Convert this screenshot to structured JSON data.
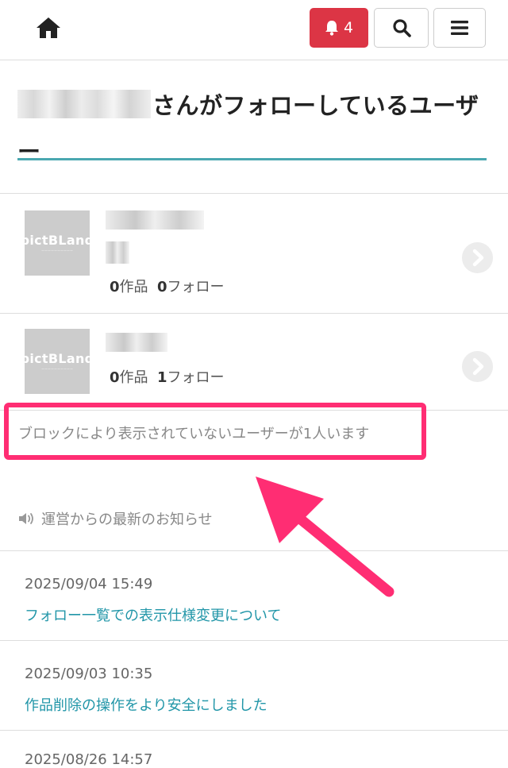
{
  "header": {
    "notification_count": "4",
    "icons": [
      "home-icon",
      "bell-icon",
      "search-icon",
      "menu-icon"
    ]
  },
  "page": {
    "title_suffix": "さんがフォローしているユーザー"
  },
  "users": [
    {
      "works_count": "0",
      "works_label": "作品",
      "follow_count": "0",
      "follow_label": "フォロー",
      "thumb_logo": "pictBLand"
    },
    {
      "works_count": "0",
      "works_label": "作品",
      "follow_count": "1",
      "follow_label": "フォロー",
      "thumb_logo": "pictBLand"
    }
  ],
  "blocked_notice": "ブロックにより表示されていないユーザーが1人います",
  "news": {
    "heading": "運営からの最新のお知らせ",
    "items": [
      {
        "date": "2025/09/04 15:49",
        "title": "フォロー一覧での表示仕様変更について"
      },
      {
        "date": "2025/09/03 10:35",
        "title": "作品削除の操作をより安全にしました"
      },
      {
        "date": "2025/08/26 14:57",
        "title": ""
      }
    ]
  },
  "colors": {
    "accent": "#4aa8b0",
    "notification": "#dc3545",
    "highlight": "#ff2d73",
    "link": "#2196a8"
  }
}
